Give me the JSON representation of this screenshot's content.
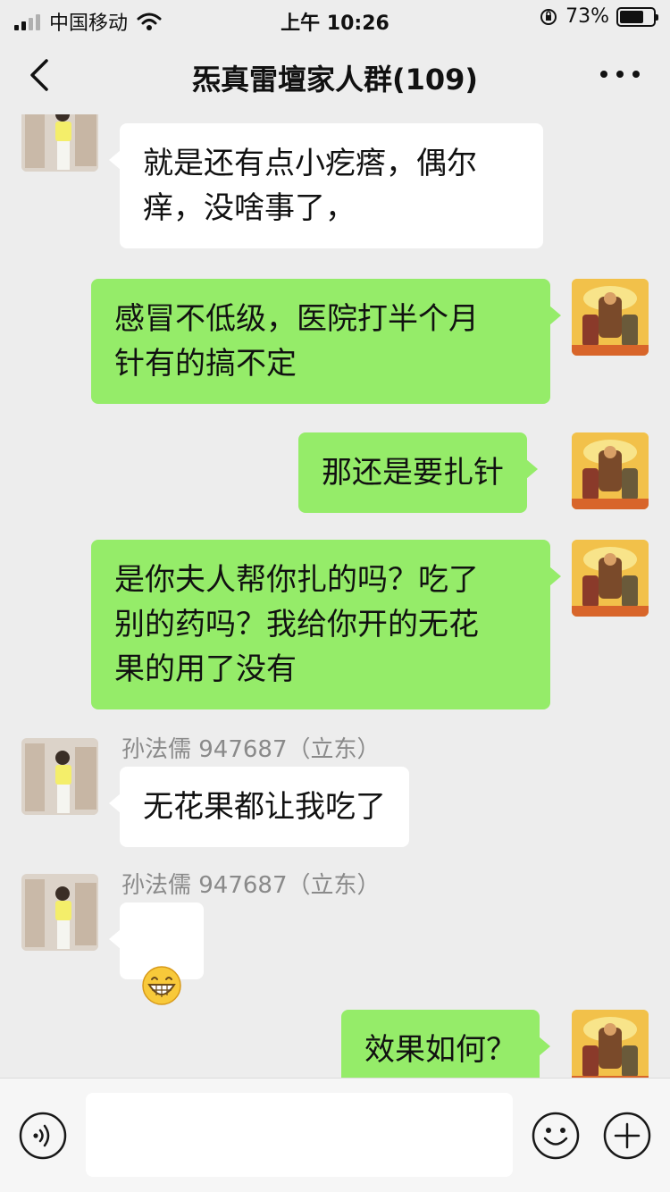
{
  "status_bar": {
    "carrier": "中国移动",
    "time": "上午 10:26",
    "battery": "73%",
    "battery_level": 0.73
  },
  "nav": {
    "title": "炁真雷壇家人群(109)",
    "back_icon": "chevron-left-icon",
    "more_icon": "more-dots-icon"
  },
  "messages": [
    {
      "sender": "",
      "direction": "in",
      "text": "就是还有点小疙瘩，偶尔\n痒，没啥事了，"
    },
    {
      "direction": "out",
      "text": "感冒不低级，医院打半个月\n针有的搞不定"
    },
    {
      "direction": "out",
      "text": "那还是要扎针"
    },
    {
      "direction": "out",
      "text": "是你夫人帮你扎的吗？吃了\n别的药吗？我给你开的无花\n果的用了没有"
    },
    {
      "sender": "孙法儒 947687（立东）",
      "direction": "in",
      "text": "无花果都让我吃了"
    },
    {
      "sender": "孙法儒 947687（立东）",
      "direction": "in",
      "emoji": "grinning-face-emoji"
    },
    {
      "direction": "out",
      "text": "效果如何？"
    }
  ],
  "input_bar": {
    "voice_icon": "voice-icon",
    "input_value": "",
    "emoji_icon": "emoji-icon",
    "plus_icon": "plus-icon"
  },
  "colors": {
    "background": "#ededed",
    "incoming_bubble": "#ffffff",
    "outgoing_bubble": "#95ec69",
    "sender_name": "#8a8a8a"
  }
}
